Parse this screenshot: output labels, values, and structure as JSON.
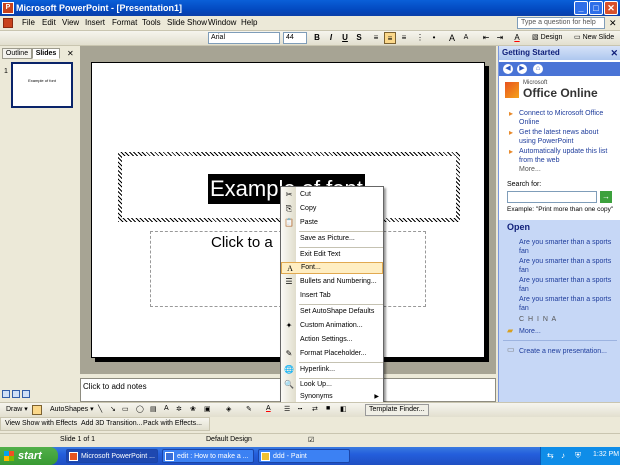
{
  "window": {
    "title": "Microsoft PowerPoint - [Presentation1]",
    "controls": [
      "_",
      "□",
      "✕"
    ]
  },
  "menubar": {
    "items": [
      "File",
      "Edit",
      "View",
      "Insert",
      "Format",
      "Tools",
      "Slide Show",
      "Window",
      "Help"
    ],
    "help_placeholder": "Type a question for help",
    "close": "✕"
  },
  "toolbar": {
    "font": "Arial",
    "size": "44",
    "bold": "B",
    "italic": "I",
    "underline": "U",
    "shadow": "S",
    "grow": "A",
    "shrink": "A",
    "design": "Design",
    "new_slide": "New Slide"
  },
  "leftpane": {
    "tabs": [
      "Outline",
      "Slides"
    ],
    "slide_number": "1",
    "thumb_text": "Example of font"
  },
  "slide": {
    "title": "Example of font",
    "body": "Click to a"
  },
  "notes": {
    "placeholder": "Click to add notes"
  },
  "taskpane": {
    "title": "Getting Started",
    "close": "✕",
    "logo_small": "Microsoft",
    "logo_big": "Office Online",
    "links": [
      "Connect to Microsoft Office Online",
      "Get the latest news about using PowerPoint",
      "Automatically update this list from the web"
    ],
    "more": "More...",
    "search_label": "Search for:",
    "search_go": "→",
    "example": "Example:  \"Print more than one copy\"",
    "open": {
      "header": "Open",
      "items": [
        "Are you smarter than a sports fan",
        "Are you smarter than a sports fan",
        "Are you smarter than a sports fan",
        "Are you smarter than a sports fan"
      ],
      "china": "C H I N A",
      "more": "More...",
      "create": "Create a new presentation..."
    }
  },
  "context_menu": {
    "items": [
      {
        "label": "Cut",
        "icon": "✂"
      },
      {
        "label": "Copy",
        "icon": "⎘"
      },
      {
        "label": "Paste",
        "icon": "📋"
      },
      {
        "label": "Save as Picture...",
        "icon": ""
      },
      {
        "label": "Exit Edit Text",
        "icon": ""
      },
      {
        "label": "Font...",
        "icon": "A"
      },
      {
        "label": "Bullets and Numbering...",
        "icon": "☰"
      },
      {
        "label": "Insert Tab",
        "icon": ""
      },
      {
        "label": "Set AutoShape Defaults",
        "icon": ""
      },
      {
        "label": "Custom Animation...",
        "icon": "✦"
      },
      {
        "label": "Action Settings...",
        "icon": ""
      },
      {
        "label": "Format Placeholder...",
        "icon": "✎"
      },
      {
        "label": "Hyperlink...",
        "icon": "🌐"
      },
      {
        "label": "Look Up...",
        "icon": "🔍"
      },
      {
        "label": "Synonyms",
        "icon": ""
      }
    ],
    "submenu_arrow": "▶"
  },
  "drawbar": {
    "draw": "Draw ▾",
    "autoshapes": "AutoShapes ▾",
    "template_finder": "Template Finder..."
  },
  "animbar": {
    "items": [
      "View Show with Effects",
      "Add 3D Transition...",
      "Pack with Effects..."
    ]
  },
  "statusbar": {
    "slide": "Slide 1 of 1",
    "design": "Default Design"
  },
  "taskbar": {
    "start": "start",
    "items": [
      "Microsoft PowerPoint ...",
      "edit : How to make a ...",
      "ddd - Paint"
    ],
    "clock": "1:32 PM"
  },
  "colors": {
    "titlebar": "#0a5fd8",
    "taskbar": "#245edc",
    "start": "#389a32",
    "highlight": "#ffeec2"
  }
}
